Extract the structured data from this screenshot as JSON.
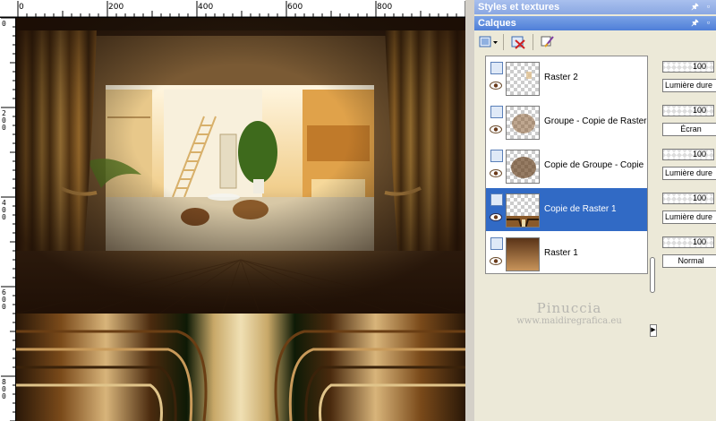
{
  "canvas": {
    "top_ruler_labels": [
      "0",
      "200",
      "400",
      "600",
      "800"
    ],
    "left_ruler_labels": [
      "0",
      "2\n0\n0",
      "4\n0\n0",
      "6\n0\n0",
      "8\n0\n0"
    ]
  },
  "styles_panel": {
    "title": "Styles et textures",
    "pin": "🖈",
    "restore": "▫"
  },
  "layers_panel": {
    "title": "Calques",
    "pin": "🖈",
    "restore": "▫",
    "toolbar": {
      "new_layer_icon": "new-layer-icon",
      "delete_layer_icon": "delete-layer-icon",
      "edit_icon": "edit-brush-icon"
    },
    "layers": [
      {
        "name": "Raster 2",
        "opacity": "100",
        "blend": "Lumière dure",
        "selected": false
      },
      {
        "name": "Groupe - Copie de Raster",
        "opacity": "100",
        "blend": "Écran",
        "selected": false
      },
      {
        "name": "Copie de Groupe - Copie",
        "opacity": "100",
        "blend": "Lumière dure",
        "selected": false
      },
      {
        "name": "Copie de Raster 1",
        "opacity": "100",
        "blend": "Lumière dure",
        "selected": true
      },
      {
        "name": "Raster 1",
        "opacity": "100",
        "blend": "Normal",
        "selected": false
      }
    ],
    "dropdown_arrow": "▶",
    "scroll_arrow": "▶"
  },
  "watermark": {
    "name": "Pinuccia",
    "url": "www.maidiregrafica.eu"
  },
  "colors": {
    "title_bar": "#4f7fd8",
    "selection": "#316ac5",
    "panel_bg": "#ece9d8"
  }
}
